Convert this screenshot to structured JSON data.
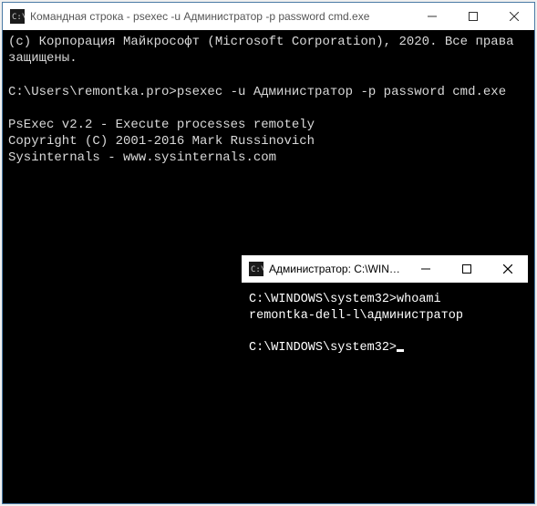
{
  "main_window": {
    "title": "Командная строка - psexec  -u Администратор -p password cmd.exe",
    "terminal": {
      "line1": "(с) Корпорация Майкрософт (Microsoft Corporation), 2020. Все права защищены.",
      "blank1": "",
      "line2": "C:\\Users\\remontka.pro>psexec -u Администратор -p password cmd.exe",
      "blank2": "",
      "line3": "PsExec v2.2 - Execute processes remotely",
      "line4": "Copyright (C) 2001-2016 Mark Russinovich",
      "line5": "Sysinternals - www.sysinternals.com"
    }
  },
  "child_window": {
    "title": "Администратор: C:\\WIND...",
    "terminal": {
      "line1": "C:\\WINDOWS\\system32>whoami",
      "line2": "remontka-dell-l\\администратор",
      "blank1": "",
      "prompt": "C:\\WINDOWS\\system32>"
    }
  },
  "controls": {
    "minimize": "─",
    "maximize": "☐",
    "close": "✕"
  }
}
